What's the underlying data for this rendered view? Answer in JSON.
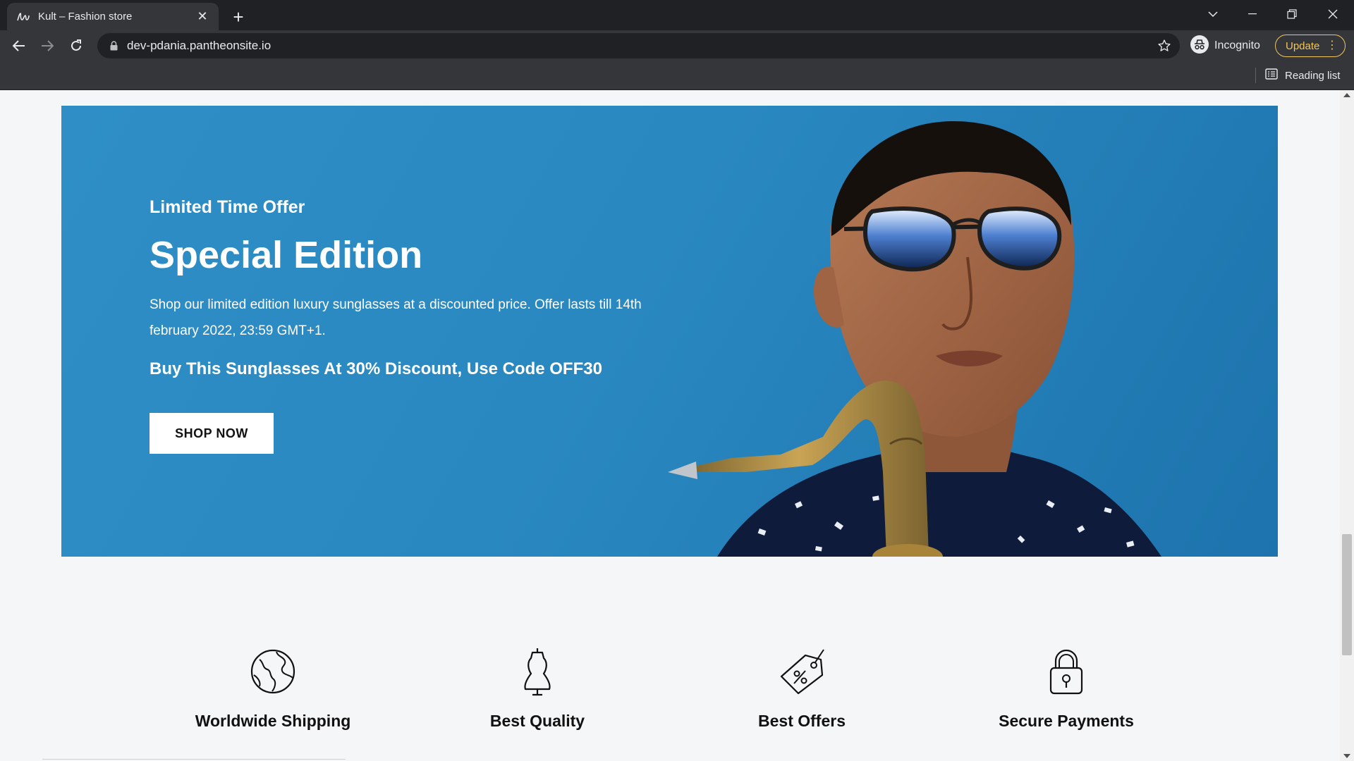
{
  "browser": {
    "tab_title": "Kult – Fashion store",
    "url": "dev-pdania.pantheonsite.io",
    "incognito_label": "Incognito",
    "update_label": "Update",
    "reading_list_label": "Reading list"
  },
  "hero": {
    "eyebrow": "Limited Time Offer",
    "headline": "Special Edition",
    "description": "Shop our limited edition luxury sunglasses at a discounted price. Offer lasts till 14th february 2022, 23:59 GMT+1.",
    "promo": "Buy This Sunglasses At 30% Discount, Use Code OFF30",
    "cta_label": "SHOP NOW",
    "background_color": "#2a88c0"
  },
  "features": [
    {
      "label": "Worldwide Shipping",
      "icon": "globe-icon"
    },
    {
      "label": "Best Quality",
      "icon": "dress-form-icon"
    },
    {
      "label": "Best Offers",
      "icon": "price-tag-icon"
    },
    {
      "label": "Secure Payments",
      "icon": "padlock-icon"
    }
  ],
  "colors": {
    "chrome_dark": "#202124",
    "chrome_toolbar": "#35363a",
    "update_accent": "#f2c55a",
    "page_background": "#f5f6f8"
  }
}
